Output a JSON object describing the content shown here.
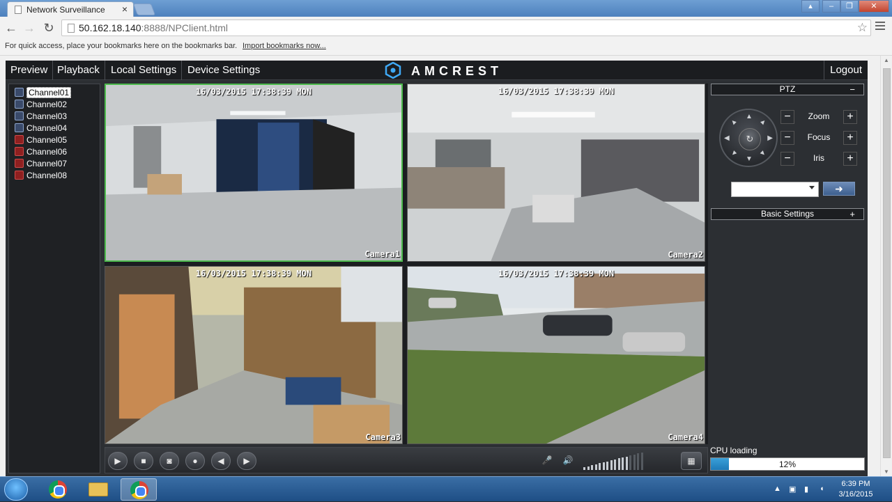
{
  "browser": {
    "tab_title": "Network Surveillance",
    "url_host": "50.162.18.140",
    "url_rest": ":8888/NPClient.html",
    "bookmarks_message": "For quick access, place your bookmarks here on the bookmarks bar.",
    "import_bookmarks": "Import bookmarks now..."
  },
  "nav": {
    "items": [
      "Preview",
      "Playback",
      "Local Settings",
      "Device Settings"
    ],
    "brand": "AMCREST",
    "logout": "Logout"
  },
  "channels": [
    {
      "label": "Channel01",
      "status": "online",
      "selected": true
    },
    {
      "label": "Channel02",
      "status": "online",
      "selected": false
    },
    {
      "label": "Channel03",
      "status": "online",
      "selected": false
    },
    {
      "label": "Channel04",
      "status": "online",
      "selected": false
    },
    {
      "label": "Channel05",
      "status": "offline",
      "selected": false
    },
    {
      "label": "Channel06",
      "status": "offline",
      "selected": false
    },
    {
      "label": "Channel07",
      "status": "offline",
      "selected": false
    },
    {
      "label": "Channel08",
      "status": "offline",
      "selected": false
    }
  ],
  "cameras": [
    {
      "timestamp": "16/03/2015 17:38:39 MON",
      "name": "Camera1",
      "selected": true
    },
    {
      "timestamp": "16/03/2015 17:38:39 MON",
      "name": "Camera2",
      "selected": false
    },
    {
      "timestamp": "16/03/2015 17:38:39 MON",
      "name": "Camera3",
      "selected": false
    },
    {
      "timestamp": "16/03/2015 17:38:39 MON",
      "name": "Camera4",
      "selected": false
    }
  ],
  "controls": {
    "icons": [
      "play-icon",
      "stop-icon",
      "snapshot-icon",
      "record-icon",
      "prev-icon",
      "next-icon",
      "microphone-icon",
      "speaker-icon",
      "volume-level-icon",
      "layout-grid-icon"
    ],
    "volume_level": 0.75
  },
  "ptz": {
    "title": "PTZ",
    "collapse_symbol": "−",
    "zoom_label": "Zoom",
    "focus_label": "Focus",
    "iris_label": "Iris",
    "preset_value": ""
  },
  "basic_settings": {
    "title": "Basic Settings",
    "expand_symbol": "+"
  },
  "cpu": {
    "label": "CPU loading",
    "percent_text": "12%",
    "fraction": 0.12
  },
  "taskbar": {
    "time": "6:39 PM",
    "date": "3/16/2015"
  },
  "colors": {
    "selection_border": "#4cbb4c",
    "cpu_fill": "#1e7ab8",
    "panel_bg": "#2c2f33"
  }
}
